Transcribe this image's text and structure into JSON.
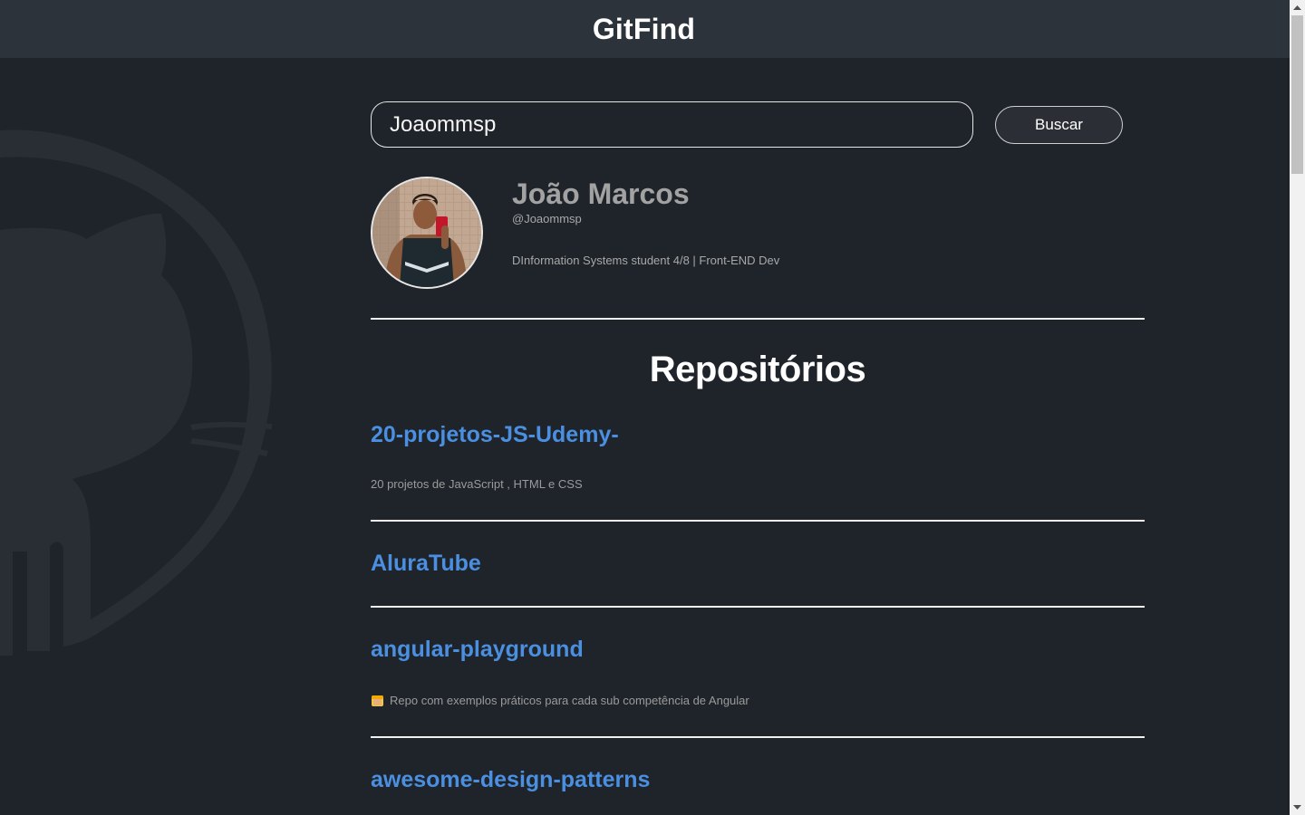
{
  "header": {
    "title": "GitFind"
  },
  "search": {
    "value": "Joaommsp",
    "button_label": "Buscar"
  },
  "profile": {
    "name": "João Marcos",
    "login": "@Joaommsp",
    "bio": "DInformation Systems student 4/8 | Front-END Dev"
  },
  "repos_section": {
    "title": "Repositórios",
    "items": [
      {
        "name": "20-projetos-JS-Udemy-",
        "description": "20 projetos de JavaScript , HTML e CSS"
      },
      {
        "name": "AluraTube",
        "description": ""
      },
      {
        "name": "angular-playground",
        "description": "Repo com exemplos práticos para cada sub competência de Angular"
      },
      {
        "name": "awesome-design-patterns",
        "description": ""
      }
    ]
  },
  "colors": {
    "background": "#1f232a",
    "header": "#2d333b",
    "link": "#4a8fe0",
    "text_muted": "#a9a9a9"
  },
  "icons": {
    "background": "github-octocat-icon",
    "repo_description_prefix": "construction-worker-emoji-icon"
  }
}
